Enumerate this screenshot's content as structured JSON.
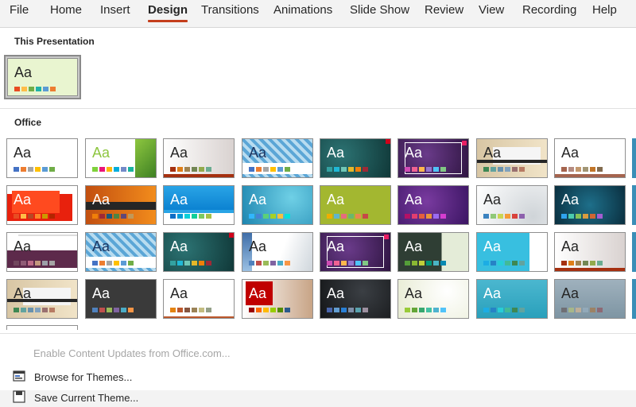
{
  "ribbon": {
    "tabs": [
      {
        "label": "File",
        "active": false
      },
      {
        "label": "Home",
        "active": false
      },
      {
        "label": "Insert",
        "active": false
      },
      {
        "label": "Design",
        "active": true
      },
      {
        "label": "Transitions",
        "active": false
      },
      {
        "label": "Animations",
        "active": false
      },
      {
        "label": "Slide Show",
        "active": false
      },
      {
        "label": "Review",
        "active": false
      },
      {
        "label": "View",
        "active": false
      },
      {
        "label": "Recording",
        "active": false
      },
      {
        "label": "Help",
        "active": false
      }
    ]
  },
  "gallery": {
    "current_section_title": "This Presentation",
    "office_section_title": "Office",
    "thumbnail_text": "Aa"
  },
  "commands": {
    "enable_updates": "Enable Content Updates from Office.com...",
    "browse_themes": "Browse for Themes...",
    "save_theme": "Save Current Theme..."
  },
  "colors": {
    "accent": "#c43e1c",
    "current_theme_bg": "#e9f5d0"
  },
  "icons": {
    "browse": "browse-themes-icon",
    "save": "save-theme-icon"
  }
}
